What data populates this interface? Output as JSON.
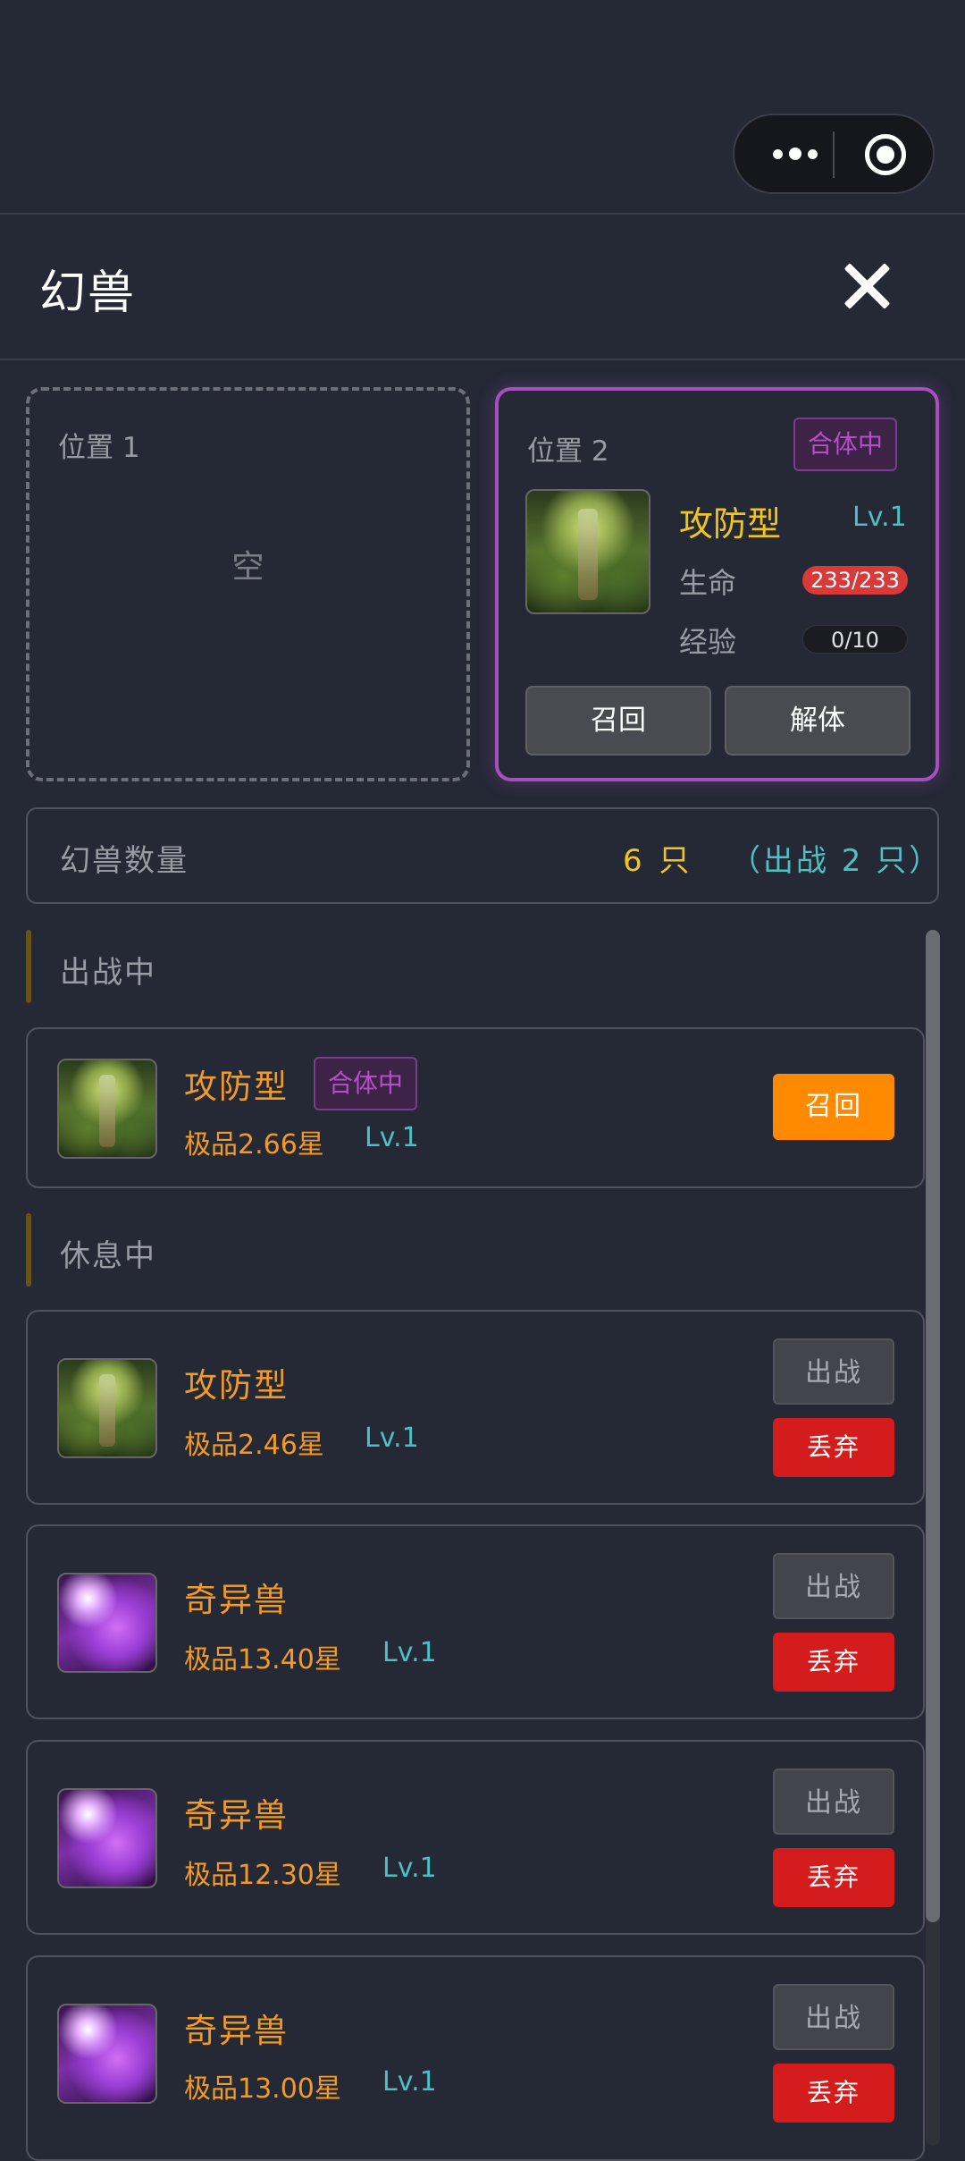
{
  "header": {
    "title": "幻兽"
  },
  "slots": {
    "slot1": {
      "label": "位置 1",
      "empty_text": "空"
    },
    "slot2": {
      "label": "位置 2",
      "badge": "合体中",
      "pet_name": "攻防型",
      "level": "Lv.1",
      "hp_label": "生命",
      "hp_value": "233/233",
      "exp_label": "经验",
      "exp_value": "0/10",
      "recall_label": "召回",
      "unmerge_label": "解体"
    }
  },
  "count_bar": {
    "label": "幻兽数量",
    "count": "6 只",
    "deployed": "（出战 2 只）"
  },
  "sections": {
    "active": "出战中",
    "resting": "休息中"
  },
  "active_pets": [
    {
      "name": "攻防型",
      "badge": "合体中",
      "quality": "极品2.66星",
      "level": "Lv.1",
      "action": "召回"
    }
  ],
  "resting_pets": [
    {
      "name": "攻防型",
      "quality": "极品2.46星",
      "level": "Lv.1",
      "deploy": "出战",
      "discard": "丢弃"
    },
    {
      "name": "奇异兽",
      "quality": "极品13.40星",
      "level": "Lv.1",
      "deploy": "出战",
      "discard": "丢弃"
    },
    {
      "name": "奇异兽",
      "quality": "极品12.30星",
      "level": "Lv.1",
      "deploy": "出战",
      "discard": "丢弃"
    },
    {
      "name": "奇异兽",
      "quality": "极品13.00星",
      "level": "Lv.1",
      "deploy": "出战",
      "discard": "丢弃"
    }
  ],
  "colors": {
    "background": "#252936",
    "accent_purple": "#a64fbf",
    "gold": "#f0c51d",
    "orange": "#f29a26",
    "cyan": "#4fc0c0",
    "red": "#d41c1c",
    "button_orange": "#ff8a00"
  }
}
